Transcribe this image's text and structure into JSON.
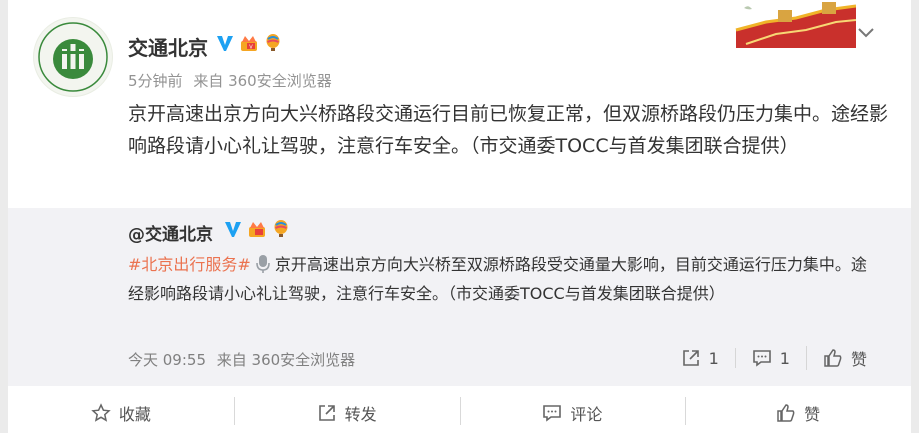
{
  "post": {
    "author": "交通北京",
    "time": "5分钟前",
    "source": "来自 360安全浏览器",
    "text": "京开高速出京方向大兴桥路段交通运行目前已恢复正常，但双源桥路段仍压力集中。途经影响路段请小心礼让驾驶，注意行车安全。（市交通委TOCC与首发集团联合提供）",
    "avatar_ring_text": "北京市交通委员会 Beijing Municipal Commission of Transport",
    "badges": [
      "verified-v-icon",
      "vip-crown-icon",
      "balloon-icon"
    ]
  },
  "repost": {
    "author": "@交通北京",
    "hashtag": "#北京出行服务#",
    "text": "京开高速出京方向大兴桥至双源桥路段受交通量大影响，目前交通运行压力集中。途经影响路段请小心礼让驾驶，注意行车安全。（市交通委TOCC与首发集团联合提供）",
    "time": "今天 09:55",
    "source": "来自 360安全浏览器",
    "repost_count": "1",
    "comment_count": "1",
    "like_label": "赞"
  },
  "actions": {
    "favorite": "收藏",
    "repost": "转发",
    "comment": "评论",
    "like": "赞"
  },
  "colors": {
    "hashtag": "#eb7350",
    "verified": "#1da1f2",
    "repost_bg": "#f2f2f5",
    "meta": "#939393"
  }
}
